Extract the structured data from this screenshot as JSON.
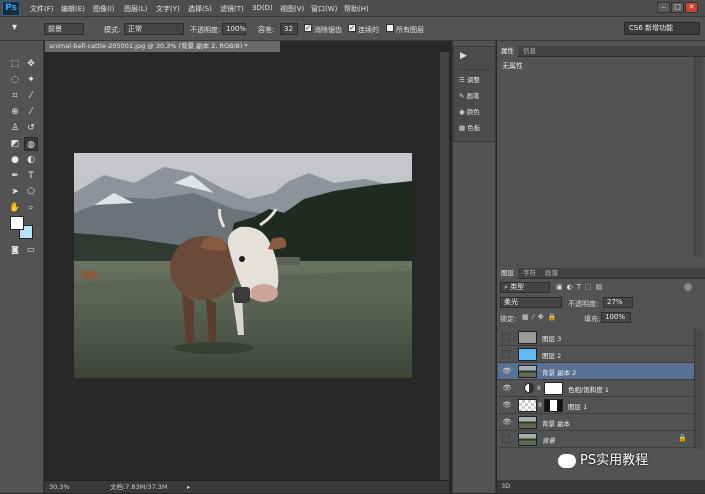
{
  "app": {
    "logo": "Ps"
  },
  "menu": [
    "文件(F)",
    "编辑(E)",
    "图像(I)",
    "图层(L)",
    "文字(Y)",
    "选择(S)",
    "滤镜(T)",
    "3D(D)",
    "视图(V)",
    "窗口(W)",
    "帮助(H)"
  ],
  "window_buttons": {
    "minimize": "–",
    "restore": "□",
    "close": "✕"
  },
  "options": {
    "preset": "前景",
    "mode_label": "模式:",
    "mode_value": "正常",
    "opacity_label": "不透明度:",
    "opacity_value": "100%",
    "tolerance_label": "容差:",
    "tolerance_value": "32",
    "antialias_label": "消除锯齿",
    "contiguous_label": "连续的",
    "all_layers_label": "所有图层",
    "workspace": "CS6 新增功能"
  },
  "document": {
    "tab_title": "animal-bell-cattle-205001.jpg @ 30.3% (背景 副本 2, RGB/8) *",
    "zoom": "30.3%",
    "doc_size": "文档:7.83M/37.3M"
  },
  "mini_panel": [
    "调整",
    "画笔",
    "颜色",
    "色板"
  ],
  "properties": {
    "tabs": [
      "属性",
      "信息"
    ],
    "title": "无属性"
  },
  "layers_panel": {
    "tabs": [
      "图层",
      "字符",
      "段落"
    ],
    "filter_type": "类型",
    "blend_mode": "柔光",
    "opacity_label": "不透明度:",
    "opacity_value": "27%",
    "lock_label": "锁定:",
    "fill_label": "填充:",
    "fill_value": "100%",
    "layers": [
      {
        "name": "图层 3",
        "visible": false,
        "thumb": "#9a9a9a"
      },
      {
        "name": "图层 2",
        "visible": false,
        "thumb": "#63b8f3"
      },
      {
        "name": "背景 副本 2",
        "visible": true,
        "thumb": "photo",
        "selected": true
      },
      {
        "name": "色相/饱和度 1",
        "visible": true,
        "thumb": "adjust"
      },
      {
        "name": "图层 1",
        "visible": true,
        "thumb": "transparent"
      },
      {
        "name": "背景 副本",
        "visible": true,
        "thumb": "photo"
      },
      {
        "name": "背景",
        "visible": false,
        "thumb": "photo",
        "locked": true
      }
    ]
  },
  "bottom": {
    "threed": "3D"
  },
  "watermark": "PS实用教程",
  "colors": {
    "accent": "#31a8ff",
    "selected_row": "#5a7292",
    "fg": "#ffffff",
    "bg": "#b6e3f7"
  }
}
